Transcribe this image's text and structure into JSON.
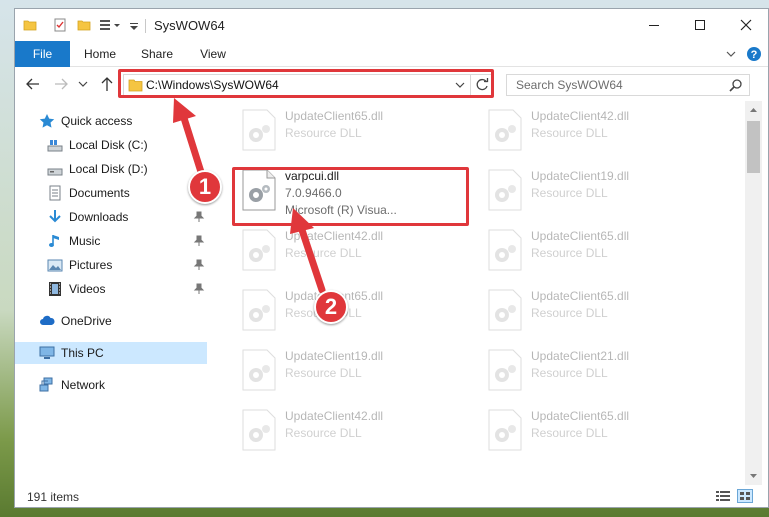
{
  "window": {
    "title": "SysWOW64",
    "controls": {
      "minimize": "—",
      "maximize": "☐",
      "close": "✕"
    }
  },
  "ribbon": {
    "tabs": [
      "File",
      "Home",
      "Share",
      "View"
    ]
  },
  "address": {
    "path": "C:\\Windows\\SysWOW64",
    "search_placeholder": "Search SysWOW64"
  },
  "nav": {
    "items": [
      {
        "label": "Quick access",
        "icon": "star-icon",
        "pinned": false
      },
      {
        "label": "Local Disk (C:)",
        "icon": "drive-icon",
        "pinned": false
      },
      {
        "label": "Local Disk (D:)",
        "icon": "drive-icon",
        "pinned": false
      },
      {
        "label": "Documents",
        "icon": "documents-icon",
        "pinned": false
      },
      {
        "label": "Downloads",
        "icon": "download-icon",
        "pinned": true
      },
      {
        "label": "Music",
        "icon": "music-icon",
        "pinned": true
      },
      {
        "label": "Pictures",
        "icon": "pictures-icon",
        "pinned": true
      },
      {
        "label": "Videos",
        "icon": "videos-icon",
        "pinned": true
      },
      {
        "label": "OneDrive",
        "icon": "cloud-icon",
        "pinned": false
      },
      {
        "label": "This PC",
        "icon": "computer-icon",
        "pinned": false,
        "selected": true
      },
      {
        "label": "Network",
        "icon": "network-icon",
        "pinned": false
      }
    ]
  },
  "files": {
    "left": [
      {
        "name": "UpdateClient65.dll",
        "desc": "Resource DLL"
      },
      {
        "name": "varpcui.dll",
        "version": "7.0.9466.0",
        "company": "Microsoft (R) Visua...",
        "highlight": true
      },
      {
        "name": "UpdateClient42.dll",
        "desc": "Resource DLL"
      },
      {
        "name": "UpdateClient65.dll",
        "desc": "Resource DLL"
      },
      {
        "name": "UpdateClient19.dll",
        "desc": "Resource DLL"
      },
      {
        "name": "UpdateClient42.dll",
        "desc": "Resource DLL"
      }
    ],
    "right": [
      {
        "name": "UpdateClient42.dll",
        "desc": "Resource DLL"
      },
      {
        "name": "UpdateClient19.dll",
        "desc": "Resource DLL"
      },
      {
        "name": "UpdateClient65.dll",
        "desc": "Resource DLL"
      },
      {
        "name": "UpdateClient65.dll",
        "desc": "Resource DLL"
      },
      {
        "name": "UpdateClient21.dll",
        "desc": "Resource DLL"
      },
      {
        "name": "UpdateClient65.dll",
        "desc": "Resource DLL"
      }
    ]
  },
  "status": {
    "count": "191 items"
  },
  "annotations": {
    "step1": "1",
    "step2": "2",
    "color": "#e0373b"
  }
}
